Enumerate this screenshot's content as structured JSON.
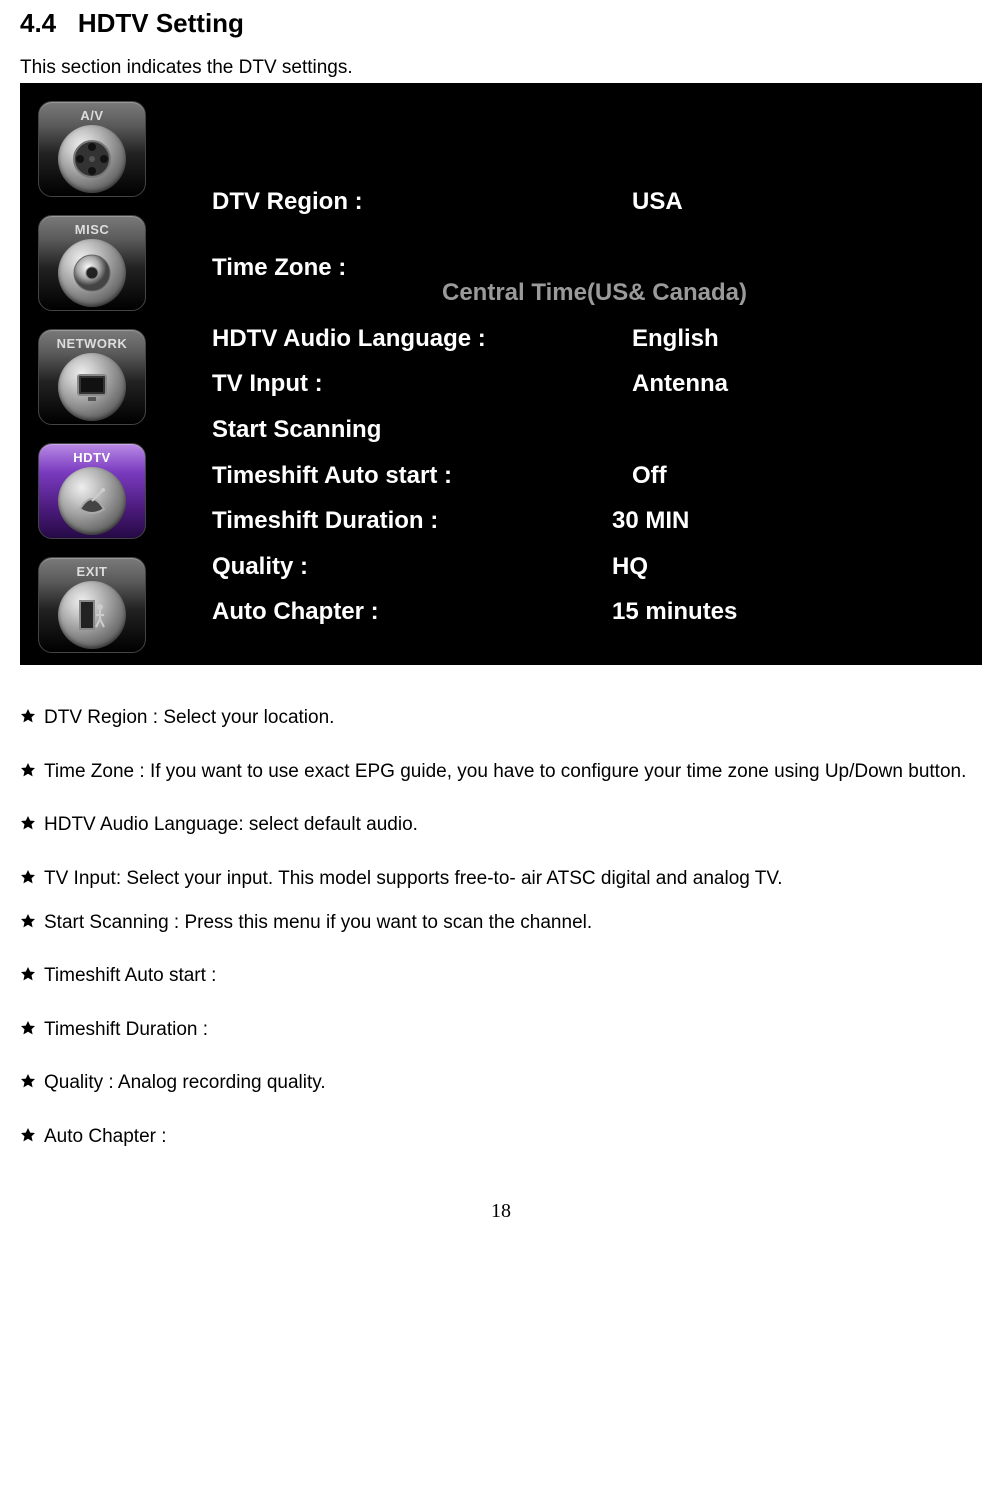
{
  "section": {
    "number": "4.4",
    "title": "HDTV Setting",
    "intro": "This section indicates the DTV settings."
  },
  "sidebar": {
    "items": [
      {
        "label": "A/V",
        "icon": "av",
        "selected": false
      },
      {
        "label": "MISC",
        "icon": "misc",
        "selected": false
      },
      {
        "label": "NETWORK",
        "icon": "network",
        "selected": false
      },
      {
        "label": "HDTV",
        "icon": "hdtv",
        "selected": true
      },
      {
        "label": "EXIT",
        "icon": "exit",
        "selected": false
      }
    ]
  },
  "settings": {
    "dtv_region": {
      "label": "DTV Region :",
      "value": "USA"
    },
    "time_zone": {
      "label": "Time Zone :",
      "value": "Central Time(US& Canada)"
    },
    "audio_lang": {
      "label": "HDTV Audio Language :",
      "value": "English"
    },
    "tv_input": {
      "label": "TV Input :",
      "value": "Antenna"
    },
    "start_scan": {
      "label": "Start Scanning",
      "value": ""
    },
    "timeshift_auto": {
      "label": "Timeshift Auto start :",
      "value": "Off"
    },
    "timeshift_dur": {
      "label": "Timeshift Duration :",
      "value": "30 MIN"
    },
    "quality": {
      "label": "Quality :",
      "value": "HQ"
    },
    "auto_chap": {
      "label": "Auto Chapter :",
      "value": "15 minutes"
    }
  },
  "descriptions": [
    "DTV Region : Select your location.",
    "Time Zone : If you want to use exact EPG guide, you have to configure your time zone using Up/Down button.",
    "HDTV Audio Language: select default audio.",
    "TV Input: Select your input. This model supports free-to- air ATSC digital and analog TV.",
    "Start Scanning : Press this menu if you want to scan the channel.",
    "Timeshift Auto start :",
    "Timeshift Duration :",
    "Quality : Analog recording quality.",
    "Auto Chapter :"
  ],
  "page_number": "18"
}
